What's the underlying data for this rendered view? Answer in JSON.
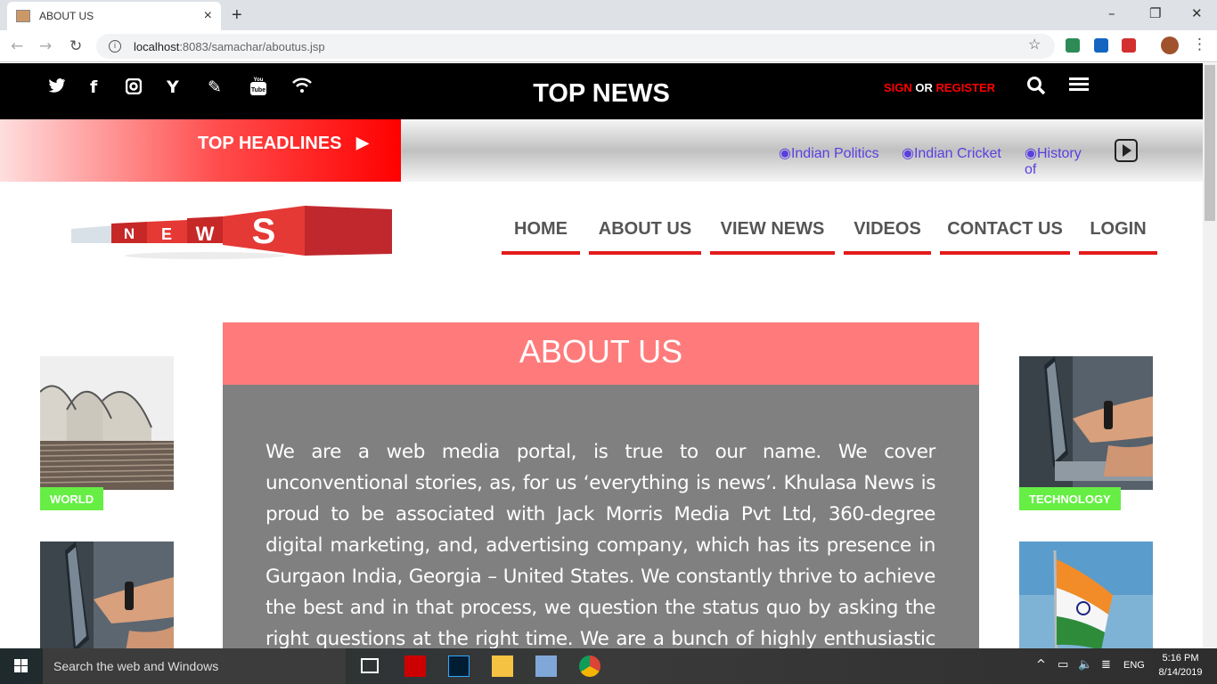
{
  "browser": {
    "tab_title": "ABOUT US",
    "tab_close": "×",
    "new_tab": "+",
    "url_host": "localhost",
    "url_path": ":8083/samachar/aboutus.jsp",
    "window_controls": {
      "minimize": "–",
      "maximize": "❐",
      "close": "✕"
    },
    "icons": [
      "back-icon",
      "forward-icon",
      "reload-icon",
      "info-icon",
      "star-icon"
    ]
  },
  "topbar": {
    "social_icons": [
      "twitter-icon",
      "facebook-icon",
      "instagram-icon",
      "yahoo-icon",
      "pencil-icon",
      "youtube-icon",
      "wifi-icon"
    ],
    "title": "TOP NEWS",
    "sign": "SIGN",
    "or": "OR",
    "register": "REGISTER"
  },
  "headlines": {
    "label": "TOP HEADLINES",
    "items": [
      "◉Indian Politics",
      "◉Indian Cricket",
      "◉History of"
    ]
  },
  "logo_text": "NEWS",
  "nav": {
    "items": [
      "HOME",
      "ABOUT US",
      "VIEW NEWS",
      "VIDEOS",
      "CONTACT US",
      "LOGIN"
    ]
  },
  "about": {
    "title": "ABOUT US",
    "body": "We are a web media portal, is true to our name. We cover unconventional stories, as, for us ‘everything is news’. Khulasa News is proud to be associated with Jack Morris Media Pvt Ltd, 360-degree digital marketing, and, advertising company, which has its presence in Gurgaon India, Georgia – United States. We constantly thrive to achieve the best and in that process, we question the status quo by asking the right questions at the right time. We are a bunch of highly enthusiastic people, who are"
  },
  "side": {
    "left_tag": "WORLD",
    "right_tag": "TECHNOLOGY"
  },
  "taskbar": {
    "search_placeholder": "Search the web and Windows",
    "time": "5:16 PM",
    "date": "8/14/2019",
    "lang": "ENG"
  },
  "colors": {
    "accent_red": "#e31b1b",
    "about_header": "#ff7b7b",
    "about_body": "#808080",
    "tag_green": "#66ee44",
    "ticker_blue": "#5a3fe0"
  }
}
